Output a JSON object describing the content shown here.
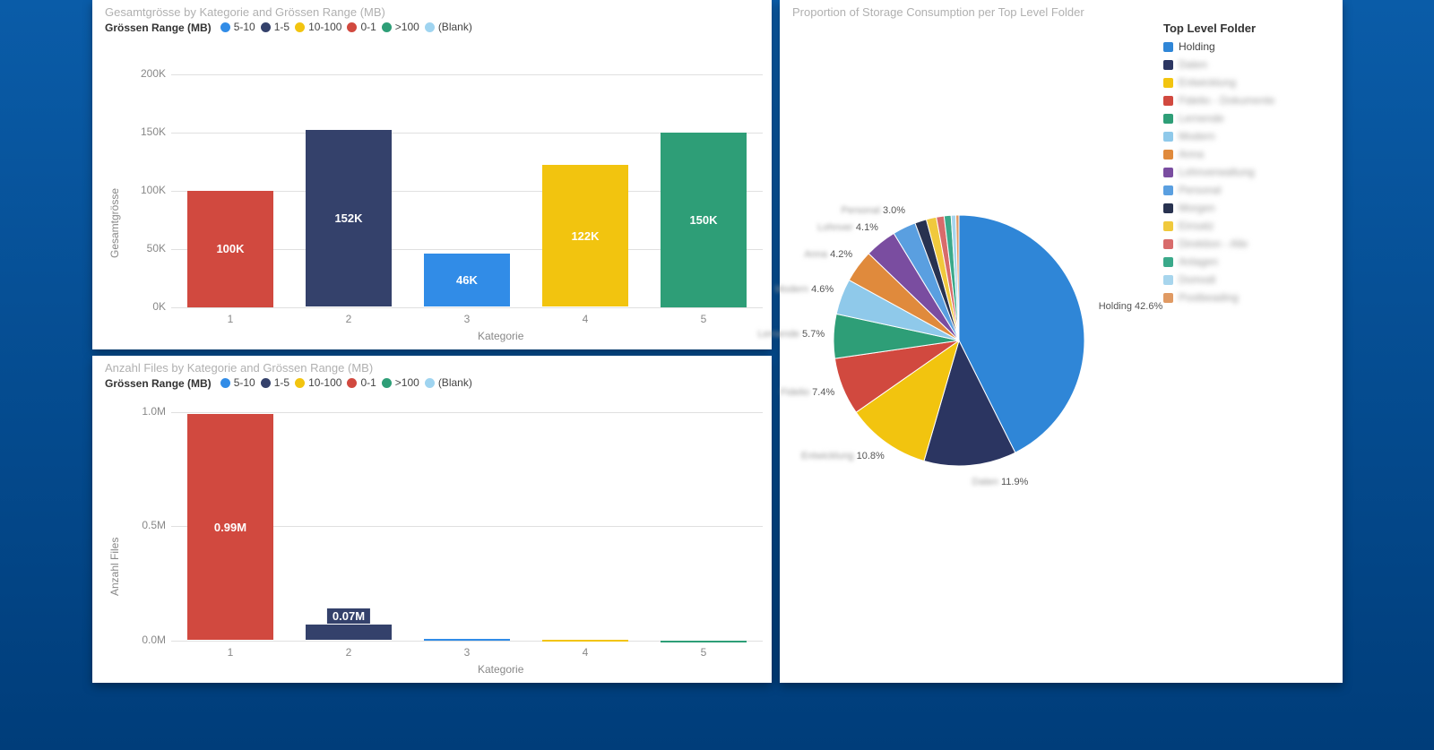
{
  "chart_data": [
    {
      "type": "bar",
      "title": "Gesamtgrösse by Kategorie and Grössen Range (MB)",
      "xlabel": "Kategorie",
      "ylabel": "Gesamtgrösse",
      "legend_title": "Grössen Range (MB)",
      "categories": [
        "1",
        "2",
        "3",
        "4",
        "5"
      ],
      "series_colors": {
        "5-10": "#318ce7",
        "1-5": "#34416b",
        "10-100": "#f2c40f",
        "0-1": "#d1493f",
        ">100": "#2e9e77",
        "(Blank)": "#9fd4f0"
      },
      "series_order": [
        "5-10",
        "1-5",
        "10-100",
        "0-1",
        ">100",
        "(Blank)"
      ],
      "bars": [
        {
          "category": "1",
          "range": "0-1",
          "value": 100000,
          "label": "100K"
        },
        {
          "category": "2",
          "range": "1-5",
          "value": 152000,
          "label": "152K"
        },
        {
          "category": "3",
          "range": "5-10",
          "value": 46000,
          "label": "46K"
        },
        {
          "category": "4",
          "range": "10-100",
          "value": 122000,
          "label": "122K"
        },
        {
          "category": "5",
          "range": ">100",
          "value": 150000,
          "label": "150K"
        }
      ],
      "yticks": [
        "0K",
        "50K",
        "100K",
        "150K",
        "200K"
      ],
      "ylim": [
        0,
        200000
      ]
    },
    {
      "type": "bar",
      "title": "Anzahl Files by Kategorie and Grössen Range (MB)",
      "xlabel": "Kategorie",
      "ylabel": "Anzahl Files",
      "legend_title": "Grössen Range (MB)",
      "categories": [
        "1",
        "2",
        "3",
        "4",
        "5"
      ],
      "series_colors": {
        "5-10": "#318ce7",
        "1-5": "#34416b",
        "10-100": "#f2c40f",
        "0-1": "#d1493f",
        ">100": "#2e9e77",
        "(Blank)": "#9fd4f0"
      },
      "series_order": [
        "5-10",
        "1-5",
        "10-100",
        "0-1",
        ">100",
        "(Blank)"
      ],
      "bars": [
        {
          "category": "1",
          "range": "0-1",
          "value": 990000,
          "label": "0.99M"
        },
        {
          "category": "2",
          "range": "1-5",
          "value": 70000,
          "label": "0.07M"
        },
        {
          "category": "3",
          "range": "5-10",
          "value": 5000,
          "label": ""
        },
        {
          "category": "4",
          "range": "10-100",
          "value": 3000,
          "label": ""
        },
        {
          "category": "5",
          "range": ">100",
          "value": 0,
          "label": ""
        }
      ],
      "yticks": [
        "0.0M",
        "0.5M",
        "1.0M"
      ],
      "ylim": [
        0,
        1000000
      ]
    },
    {
      "type": "pie",
      "title": "Proportion of Storage Consumption per Top Level Folder",
      "legend_title": "Top Level Folder",
      "slices": [
        {
          "name": "Holding",
          "pct": 42.6,
          "color": "#2f86d7",
          "blurred": false
        },
        {
          "name": "Daten",
          "pct": 11.9,
          "color": "#2b3561",
          "blurred": true
        },
        {
          "name": "Entwicklung",
          "pct": 10.8,
          "color": "#f2c40f",
          "blurred": true
        },
        {
          "name": "Fidelio - Dokumente",
          "pct": 7.4,
          "color": "#d1493f",
          "blurred": true
        },
        {
          "name": "Lernende",
          "pct": 5.7,
          "color": "#2e9e77",
          "blurred": true
        },
        {
          "name": "Modern",
          "pct": 4.6,
          "color": "#8fc9ea",
          "blurred": true
        },
        {
          "name": "Anna",
          "pct": 4.2,
          "color": "#e08a3c",
          "blurred": true
        },
        {
          "name": "Lohnverwaltung",
          "pct": 4.1,
          "color": "#7a4da0",
          "blurred": true
        },
        {
          "name": "Personal",
          "pct": 3.0,
          "color": "#5a9fe0",
          "blurred": true
        },
        {
          "name": "Morgen",
          "pct": 1.5,
          "color": "#283250",
          "blurred": true
        },
        {
          "name": "Einsatz",
          "pct": 1.3,
          "color": "#f0c93d",
          "blurred": true
        },
        {
          "name": "Direktion - Alle",
          "pct": 1.0,
          "color": "#d86b6b",
          "blurred": true
        },
        {
          "name": "Anlagen",
          "pct": 0.9,
          "color": "#3aa98a",
          "blurred": true
        },
        {
          "name": "Domodi",
          "pct": 0.6,
          "color": "#a7d5ed",
          "blurred": true
        },
        {
          "name": "Postbeading",
          "pct": 0.4,
          "color": "#e09a63",
          "blurred": true
        }
      ],
      "visible_labels": [
        {
          "name": "Holding",
          "pct": "42.6%"
        },
        {
          "name": "Daten",
          "pct": "11.9%"
        },
        {
          "name": "Entwicklung",
          "pct": "10.8%"
        },
        {
          "name": "Fidelio",
          "pct": "7.4%"
        },
        {
          "name": "Lernende",
          "pct": "5.7%"
        },
        {
          "name": "Modern",
          "pct": "4.6%"
        },
        {
          "name": "Anna",
          "pct": "4.2%"
        },
        {
          "name": "Lohnver",
          "pct": "4.1%"
        },
        {
          "name": "Personal",
          "pct": "3.0%"
        }
      ]
    }
  ]
}
